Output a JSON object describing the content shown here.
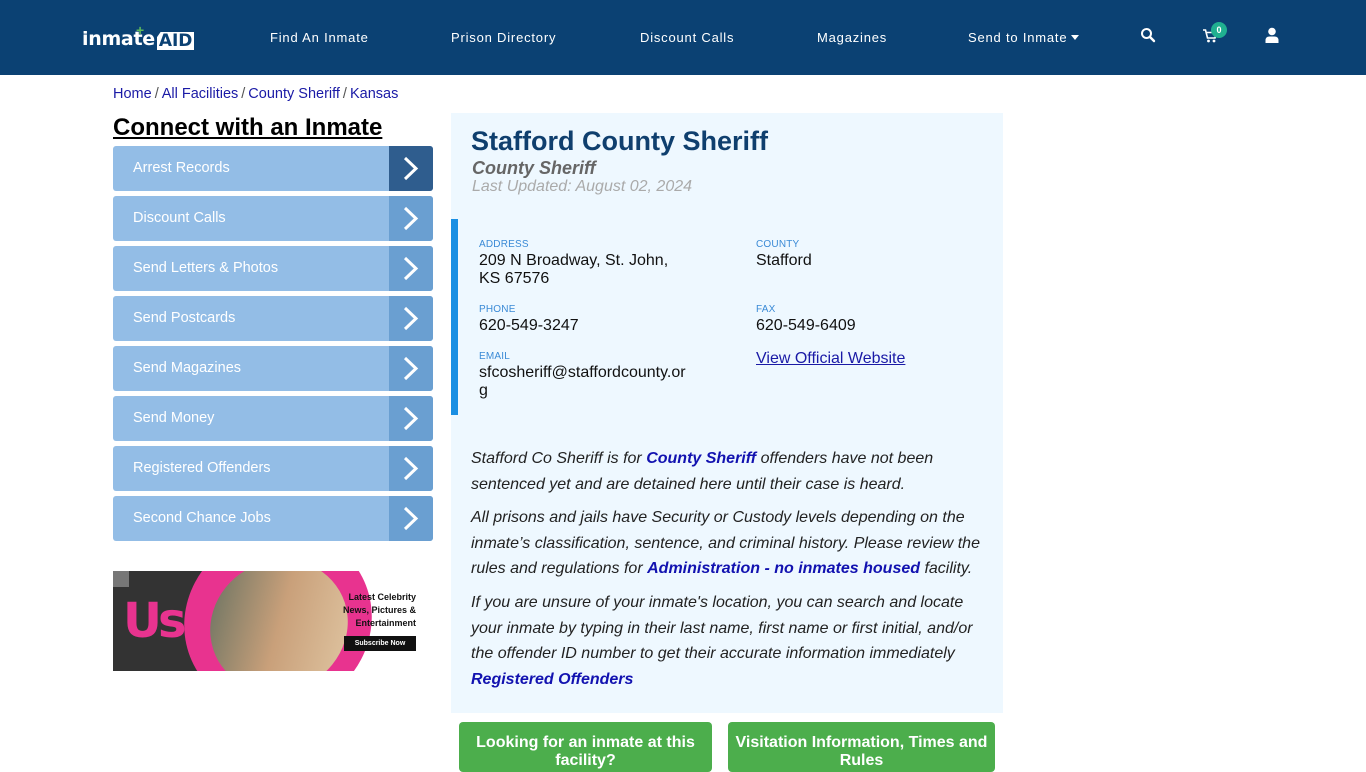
{
  "nav": {
    "logo_text": "inmate",
    "logo_accent": "AID",
    "links": [
      "Find An Inmate",
      "Prison Directory",
      "Discount Calls",
      "Magazines",
      "Send to Inmate"
    ],
    "cart_count": "0",
    "icons": [
      "search-icon",
      "cart-icon",
      "user-icon"
    ]
  },
  "breadcrumb": [
    "Home",
    "All Facilities",
    "County Sheriff",
    "Kansas"
  ],
  "sidebar": {
    "title": "Connect with an Inmate",
    "items": [
      "Arrest Records",
      "Discount Calls",
      "Send Letters & Photos",
      "Send Postcards",
      "Send Magazines",
      "Send Money",
      "Registered Offenders",
      "Second Chance Jobs"
    ],
    "ad": {
      "brand": "Us",
      "tagline": "Latest Celebrity News, Pictures & Entertainment",
      "button": "Subscribe Now"
    }
  },
  "facility": {
    "name": "Stafford County Sheriff",
    "type": "County Sheriff",
    "last_updated": "Last Updated: August 02, 2024",
    "address_label": "ADDRESS",
    "address": "209 N Broadway, St. John, KS 67576",
    "county_label": "COUNTY",
    "county": "Stafford",
    "phone_label": "PHONE",
    "phone": "620-549-3247",
    "fax_label": "FAX",
    "fax": "620-549-6409",
    "email_label": "EMAIL",
    "email": "sfcosheriff@staffordcounty.org",
    "website_link": "View Official Website"
  },
  "description": {
    "p1_a": "Stafford Co Sheriff is for ",
    "p1_link": "County Sheriff",
    "p1_b": " offenders have not been sentenced yet and are detained here until their case is heard.",
    "p2_a": "All prisons and jails have Security or Custody levels depending on the inmate’s classification, sentence, and criminal history. Please review the rules and regulations for ",
    "p2_link": "Administration - no inmates housed",
    "p2_b": " facility.",
    "p3": "If you are unsure of your inmate's location, you can search and locate your inmate by typing in their last name, first name or first initial, and/or the offender ID number to get their accurate information immediately",
    "p3_link": "Registered Offenders"
  },
  "buttons": {
    "find_inmate": "Looking for an inmate at this facility?",
    "visitation": "Visitation Information, Times and Rules"
  },
  "colors": {
    "nav_bg": "#0b4173",
    "card_bg": "#eef8ff",
    "accent_border": "#1a8fe3",
    "menu_bg": "#93bde6",
    "button_green": "#4cae4c"
  }
}
